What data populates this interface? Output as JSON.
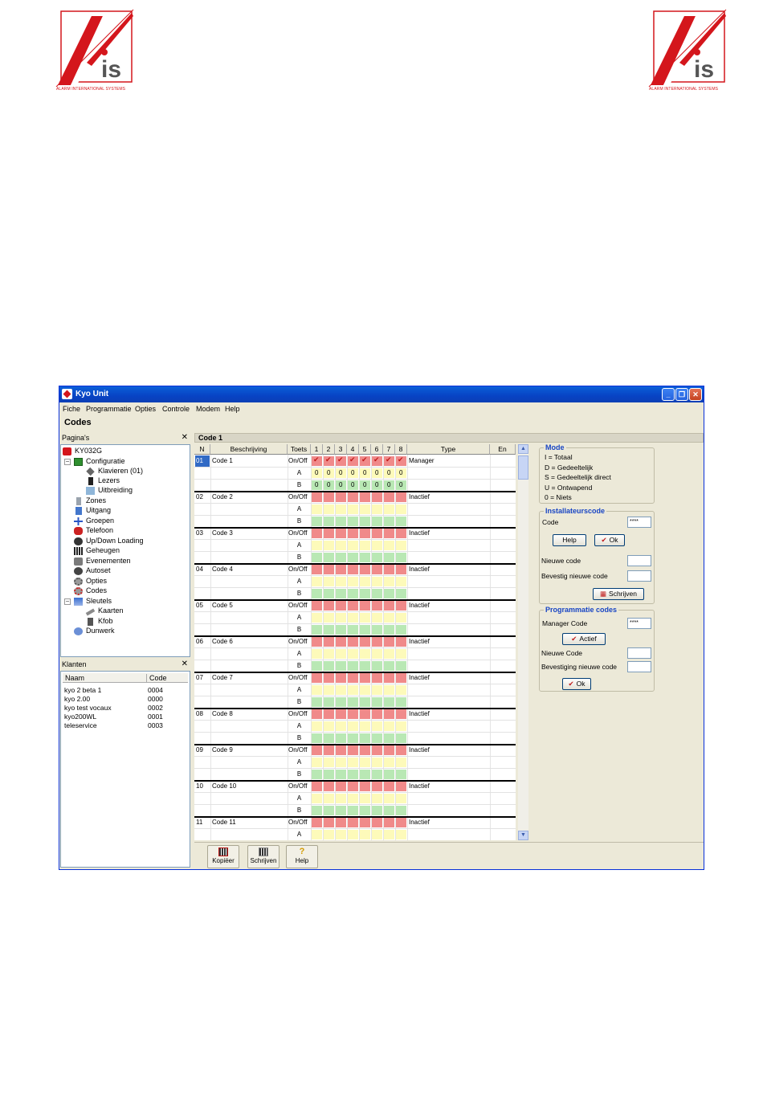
{
  "logo": {
    "tagline": "ALARM INTERNATIONAL SYSTEMS"
  },
  "window": {
    "title": "Kyo Unit",
    "menu": [
      "Fiche",
      "Programmatie",
      "Opties",
      "Controle",
      "Modem",
      "Help"
    ],
    "section_title": "Codes"
  },
  "pages_panel": {
    "title": "Pagina's",
    "items": [
      "KY032G",
      "Configuratie",
      "Klavieren (01)",
      "Lezers",
      "Uitbreiding",
      "Zones",
      "Uitgang",
      "Groepen",
      "Telefoon",
      "Up/Down Loading",
      "Geheugen",
      "Evenementen",
      "Autoset",
      "Opties",
      "Codes",
      "Sleutels",
      "Kaarten",
      "Kfob",
      "Dunwerk"
    ]
  },
  "clients_panel": {
    "title": "Klanten",
    "columns": [
      "Naam",
      "Code"
    ],
    "rows": [
      {
        "name": "kyo 2 beta 1",
        "code": "0004"
      },
      {
        "name": "kyo 2.00",
        "code": "0000"
      },
      {
        "name": "kyo test vocaux",
        "code": "0002"
      },
      {
        "name": "kyo200WL",
        "code": "0001"
      },
      {
        "name": "teleservice",
        "code": "0003"
      }
    ]
  },
  "grid": {
    "label": "Code 1",
    "columns": [
      "N",
      "Beschrijving",
      "Toets",
      "1",
      "2",
      "3",
      "4",
      "5",
      "6",
      "7",
      "8",
      "Type",
      "En"
    ],
    "row_labels": [
      "On/Off",
      "A",
      "B"
    ],
    "codes": [
      {
        "n": "01",
        "name": "Code 1",
        "type": "Manager"
      },
      {
        "n": "02",
        "name": "Code 2",
        "type": "Inactief"
      },
      {
        "n": "03",
        "name": "Code 3",
        "type": "Inactief"
      },
      {
        "n": "04",
        "name": "Code 4",
        "type": "Inactief"
      },
      {
        "n": "05",
        "name": "Code 5",
        "type": "Inactief"
      },
      {
        "n": "06",
        "name": "Code 6",
        "type": "Inactief"
      },
      {
        "n": "07",
        "name": "Code 7",
        "type": "Inactief"
      },
      {
        "n": "08",
        "name": "Code 8",
        "type": "Inactief"
      },
      {
        "n": "09",
        "name": "Code 9",
        "type": "Inactief"
      },
      {
        "n": "10",
        "name": "Code 10",
        "type": "Inactief"
      },
      {
        "n": "11",
        "name": "Code 11",
        "type": "Inactief"
      }
    ],
    "code1_ab_value": "0"
  },
  "modes": {
    "title": "Mode",
    "items": [
      "I =  Totaal",
      "D =  Gedeeltelijk",
      "S =  Gedeeltelijk direct",
      "U =  Ontwapend",
      "0 =  Niets"
    ]
  },
  "installer": {
    "title": "Installateurscode",
    "code_label": "Code",
    "code_value": "****",
    "help_label": "Help",
    "ok_label": "Ok",
    "new_code_label": "Nieuwe code",
    "confirm_label": "Bevestig nieuwe code",
    "write_label": "Schrijven"
  },
  "programming": {
    "title": "Programmatie codes",
    "manager_label": "Manager Code",
    "manager_value": "****",
    "active_label": "Actief",
    "new_code_label": "Nieuwe Code",
    "confirm_label": "Bevestiging nieuwe code",
    "ok_label": "Ok"
  },
  "toolbar": {
    "copy_label": "Kopiëer",
    "write_label": "Schrijven",
    "help_label": "Help"
  },
  "colors": {
    "on": "#f08a8a",
    "a": "#fdfaba",
    "b": "#b9e8b4",
    "check": "#c01a1a",
    "title_blue": "#1845c4"
  }
}
